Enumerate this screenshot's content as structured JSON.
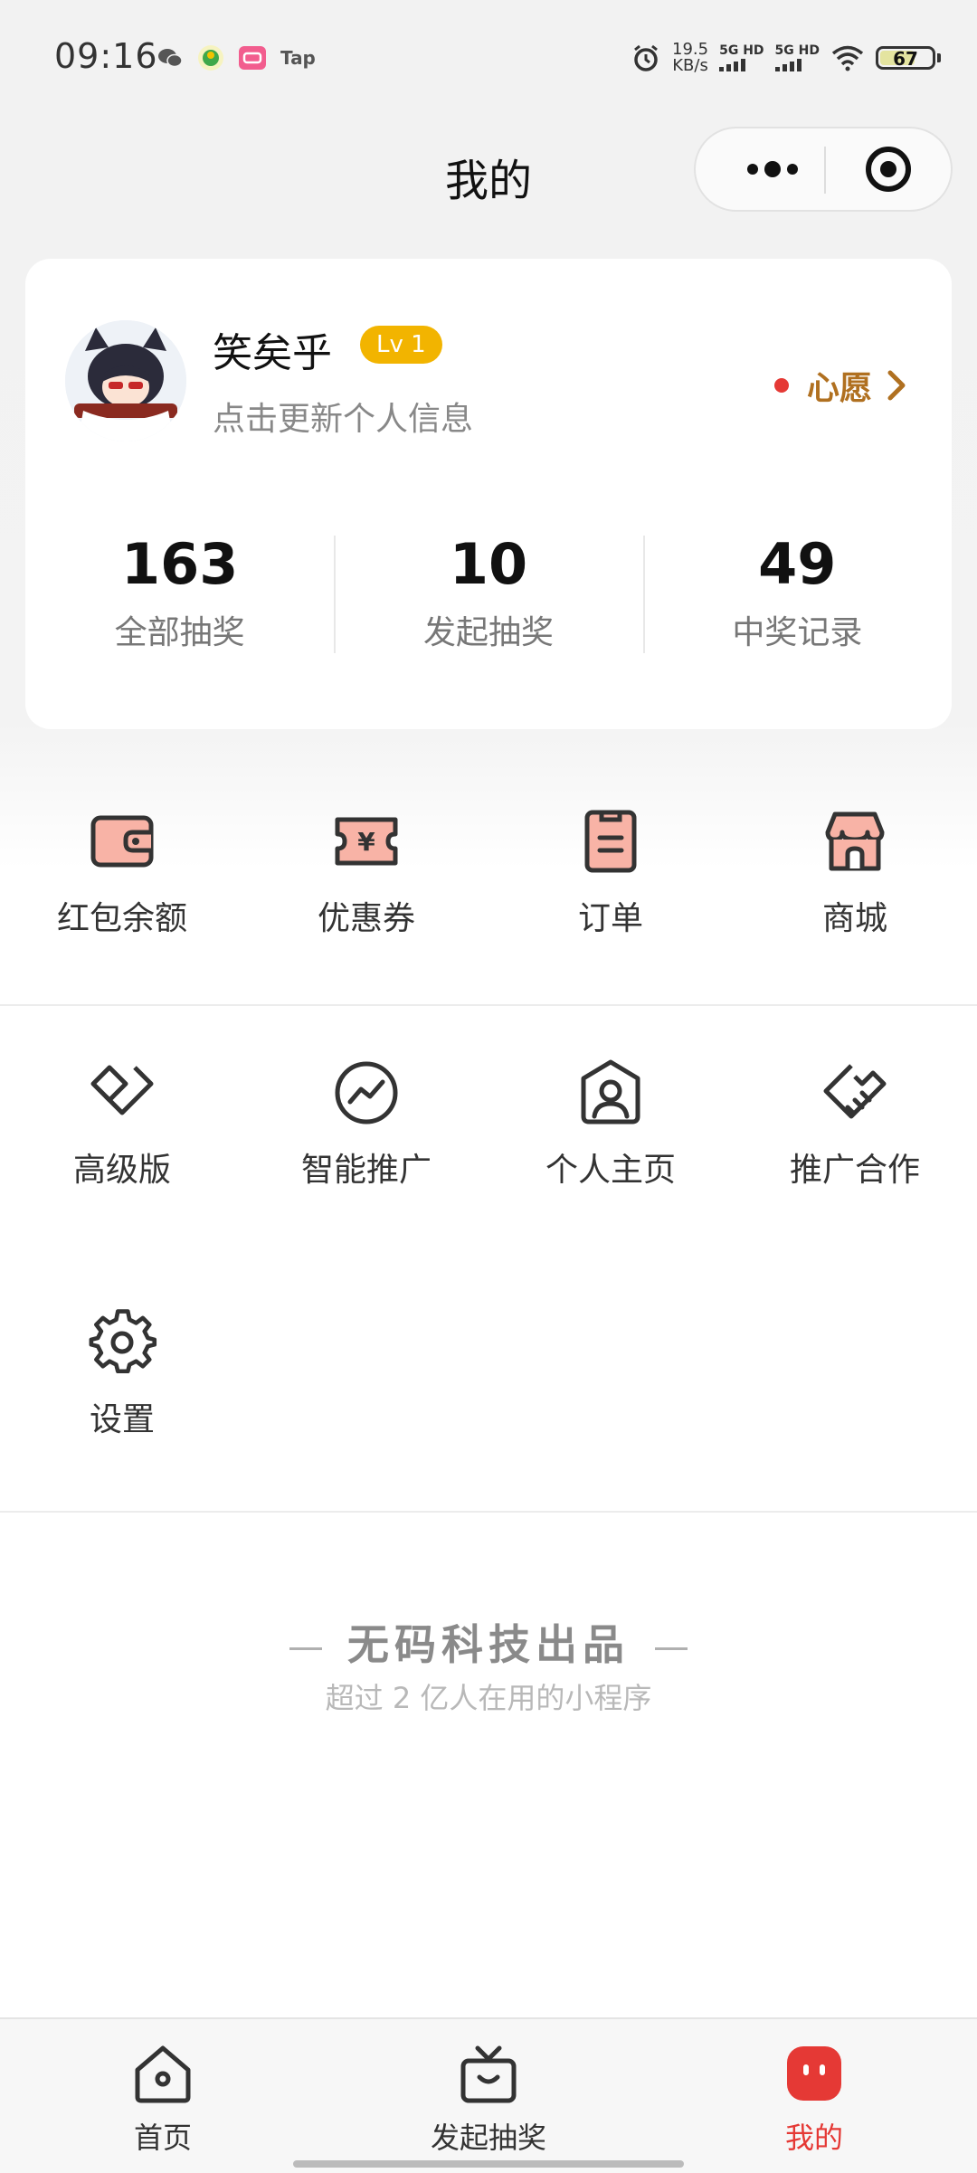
{
  "status_bar": {
    "time": "09:16",
    "app_tap_label": "Tap",
    "net_speed_value": "19.5",
    "net_speed_unit": "KB/s",
    "sim1_label": "5G HD",
    "sim2_label": "5G HD",
    "battery_level": "67",
    "battery_fraction": 0.67
  },
  "header": {
    "title": "我的"
  },
  "profile": {
    "username": "笑矣乎",
    "level": "Lv 1",
    "update_hint": "点击更新个人信息",
    "wish_label": "心愿"
  },
  "stats": [
    {
      "value": "163",
      "label": "全部抽奖"
    },
    {
      "value": "10",
      "label": "发起抽奖"
    },
    {
      "value": "49",
      "label": "中奖记录"
    }
  ],
  "quick_menu": [
    {
      "label": "红包余额",
      "icon": "wallet-icon"
    },
    {
      "label": "优惠券",
      "icon": "coupon-icon"
    },
    {
      "label": "订单",
      "icon": "order-icon"
    },
    {
      "label": "商城",
      "icon": "store-icon"
    }
  ],
  "tools_menu": [
    {
      "label": "高级版",
      "icon": "diamond-icon"
    },
    {
      "label": "智能推广",
      "icon": "trend-icon"
    },
    {
      "label": "个人主页",
      "icon": "profile-icon"
    },
    {
      "label": "推广合作",
      "icon": "handshake-icon"
    },
    {
      "label": "设置",
      "icon": "gear-icon"
    }
  ],
  "footer": {
    "brand_title": "无码科技出品",
    "brand_subtitle": "超过 2 亿人在用的小程序"
  },
  "tabbar": [
    {
      "label": "首页",
      "icon": "home-icon",
      "active": false
    },
    {
      "label": "发起抽奖",
      "icon": "gift-box-icon",
      "active": false
    },
    {
      "label": "我的",
      "icon": "mine-face-icon",
      "active": true
    }
  ],
  "colors": {
    "accent": "#e53935",
    "level_badge": "#f2b400",
    "wish_text": "#b07020",
    "icon_fill": "#f8b3a6",
    "icon_stroke": "#333333"
  }
}
